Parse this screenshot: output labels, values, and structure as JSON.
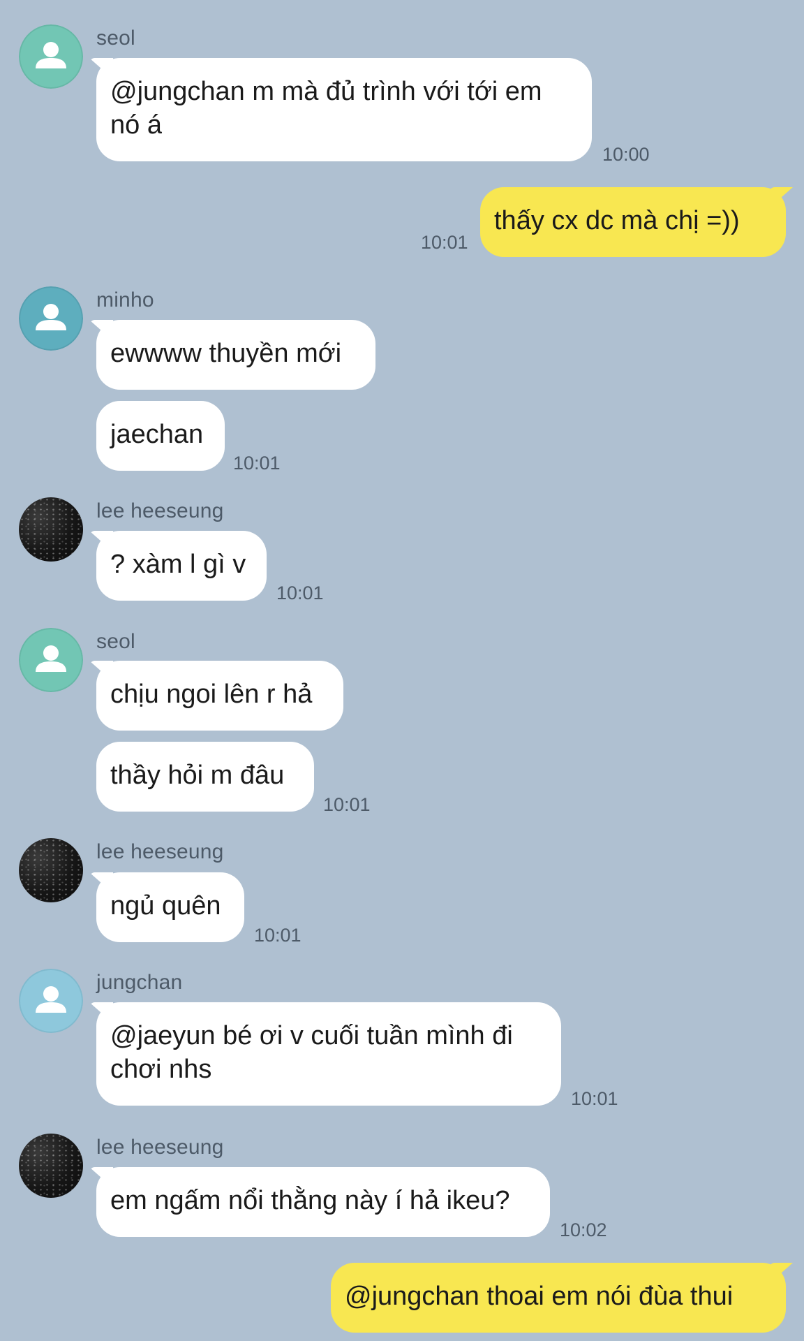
{
  "colors": {
    "background": "#afc0d1",
    "incoming_bubble": "#ffffff",
    "outgoing_bubble": "#f8e751",
    "avatar_seol": "#72c6b4",
    "avatar_minho": "#5eaebe",
    "avatar_jungchan": "#8ec8dc"
  },
  "messages": [
    {
      "sender": "seol",
      "avatar": "person-icon",
      "text": "@jungchan m mà đủ trình với tới em\nnó á",
      "time": "10:00"
    },
    {
      "sender": "me",
      "text": "thấy cx dc mà chị =))",
      "time": "10:01"
    },
    {
      "sender": "minho",
      "avatar": "person-icon",
      "text": "ewwww thuyền mới",
      "time": ""
    },
    {
      "sender": "minho",
      "text": "jaechan",
      "time": "10:01"
    },
    {
      "sender": "lee heeseung",
      "avatar": "photo-avatar",
      "text": "? xàm l gì v",
      "time": "10:01"
    },
    {
      "sender": "seol",
      "avatar": "person-icon",
      "text": "chịu ngoi lên r hả",
      "time": ""
    },
    {
      "sender": "seol",
      "text": "thầy hỏi m đâu",
      "time": "10:01"
    },
    {
      "sender": "lee heeseung",
      "avatar": "photo-avatar",
      "text": "ngủ quên",
      "time": "10:01"
    },
    {
      "sender": "jungchan",
      "avatar": "person-icon",
      "text": "@jaeyun bé ơi v cuối tuần mình đi\nchơi nhs",
      "time": "10:01"
    },
    {
      "sender": "lee heeseung",
      "avatar": "photo-avatar",
      "text": "em ngấm nổi thằng này í hả ikeu?",
      "time": "10:02"
    },
    {
      "sender": "me",
      "text": "@jungchan thoai em nói đùa thui",
      "time": ""
    }
  ]
}
